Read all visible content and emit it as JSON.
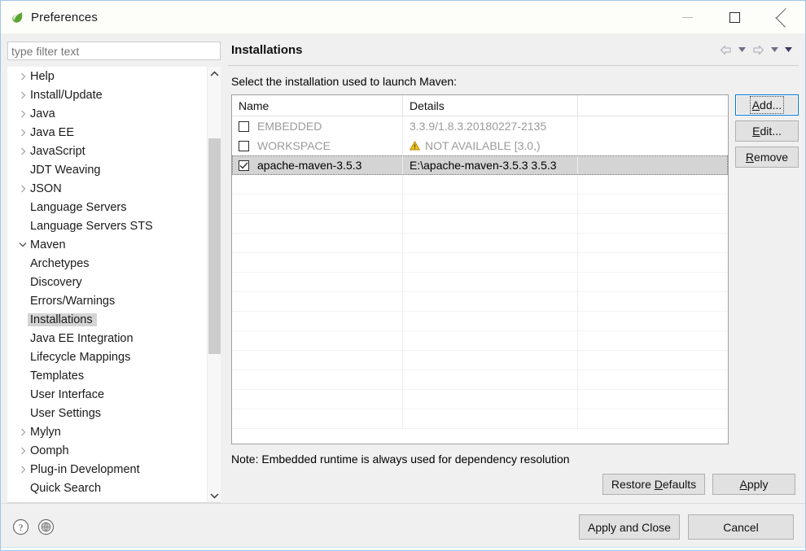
{
  "window": {
    "title": "Preferences",
    "logo_icon": "spring-leaf-icon",
    "controls": [
      {
        "name": "minimize-button",
        "icon": "minimize-icon"
      },
      {
        "name": "maximize-button",
        "icon": "maximize-icon"
      },
      {
        "name": "close-button",
        "icon": "close-icon"
      }
    ]
  },
  "filter": {
    "value": "",
    "placeholder": "type filter text"
  },
  "tree": {
    "items": [
      {
        "label": "Help",
        "depth": 1,
        "twisty": "collapsed",
        "selected": false
      },
      {
        "label": "Install/Update",
        "depth": 1,
        "twisty": "collapsed",
        "selected": false
      },
      {
        "label": "Java",
        "depth": 1,
        "twisty": "collapsed",
        "selected": false
      },
      {
        "label": "Java EE",
        "depth": 1,
        "twisty": "collapsed",
        "selected": false
      },
      {
        "label": "JavaScript",
        "depth": 1,
        "twisty": "collapsed",
        "selected": false
      },
      {
        "label": "JDT Weaving",
        "depth": 1,
        "twisty": "none",
        "selected": false
      },
      {
        "label": "JSON",
        "depth": 1,
        "twisty": "collapsed",
        "selected": false
      },
      {
        "label": "Language Servers",
        "depth": 1,
        "twisty": "none",
        "selected": false
      },
      {
        "label": "Language Servers STS",
        "depth": 1,
        "twisty": "none",
        "selected": false
      },
      {
        "label": "Maven",
        "depth": 1,
        "twisty": "expanded",
        "selected": false
      },
      {
        "label": "Archetypes",
        "depth": 2,
        "twisty": "none",
        "selected": false
      },
      {
        "label": "Discovery",
        "depth": 2,
        "twisty": "none",
        "selected": false
      },
      {
        "label": "Errors/Warnings",
        "depth": 2,
        "twisty": "none",
        "selected": false
      },
      {
        "label": "Installations",
        "depth": 2,
        "twisty": "none",
        "selected": true
      },
      {
        "label": "Java EE Integration",
        "depth": 2,
        "twisty": "none",
        "selected": false
      },
      {
        "label": "Lifecycle Mappings",
        "depth": 2,
        "twisty": "none",
        "selected": false
      },
      {
        "label": "Templates",
        "depth": 2,
        "twisty": "none",
        "selected": false
      },
      {
        "label": "User Interface",
        "depth": 2,
        "twisty": "none",
        "selected": false
      },
      {
        "label": "User Settings",
        "depth": 2,
        "twisty": "none",
        "selected": false
      },
      {
        "label": "Mylyn",
        "depth": 1,
        "twisty": "collapsed",
        "selected": false
      },
      {
        "label": "Oomph",
        "depth": 1,
        "twisty": "collapsed",
        "selected": false
      },
      {
        "label": "Plug-in Development",
        "depth": 1,
        "twisty": "collapsed",
        "selected": false
      },
      {
        "label": "Quick Search",
        "depth": 1,
        "twisty": "none",
        "selected": false
      }
    ],
    "scrollbar": {
      "up_icon": "chevron-up-icon",
      "down_icon": "chevron-down-icon"
    }
  },
  "page": {
    "title": "Installations",
    "nav": [
      {
        "name": "back-button",
        "icon": "arrow-left-icon",
        "enabled": false
      },
      {
        "name": "back-history-dropdown",
        "icon": "caret-down-icon",
        "enabled": false
      },
      {
        "name": "forward-button",
        "icon": "arrow-right-icon",
        "enabled": false
      },
      {
        "name": "forward-history-dropdown",
        "icon": "caret-down-icon",
        "enabled": false
      },
      {
        "name": "view-menu-dropdown",
        "icon": "caret-down-icon",
        "enabled": true
      }
    ],
    "description": "Select the installation used to launch Maven:",
    "note": "Note: Embedded runtime is always used for dependency resolution"
  },
  "table": {
    "columns": [
      "Name",
      "Details",
      ""
    ],
    "rows": [
      {
        "checked": false,
        "name": "EMBEDDED",
        "details": "3.3.9/1.8.3.20180227-2135",
        "dim": true,
        "warning": false,
        "selected": false
      },
      {
        "checked": false,
        "name": "WORKSPACE",
        "details": "NOT AVAILABLE [3.0,)",
        "dim": true,
        "warning": true,
        "selected": false
      },
      {
        "checked": true,
        "name": "apache-maven-3.5.3",
        "details": "E:\\apache-maven-3.5.3 3.5.3",
        "dim": false,
        "warning": false,
        "selected": true
      }
    ],
    "empty_row_count": 13
  },
  "side_buttons": [
    {
      "name": "add-button",
      "label": "Add...",
      "mnemonic": "A",
      "focused": true
    },
    {
      "name": "edit-button",
      "label": "Edit...",
      "mnemonic": "E",
      "focused": false
    },
    {
      "name": "remove-button",
      "label": "Remove",
      "mnemonic": "R",
      "focused": false
    }
  ],
  "page_buttons": [
    {
      "name": "restore-defaults-button",
      "label": "Restore Defaults",
      "mnemonic": "D"
    },
    {
      "name": "apply-button",
      "label": "Apply",
      "mnemonic": "A"
    }
  ],
  "footer": {
    "icons": [
      {
        "name": "help-icon",
        "glyph": "?"
      },
      {
        "name": "globe-icon",
        "glyph": "globe"
      }
    ],
    "buttons": [
      {
        "name": "apply-and-close-button",
        "label": "Apply and Close"
      },
      {
        "name": "cancel-button",
        "label": "Cancel"
      }
    ]
  },
  "colors": {
    "accent": "#0078d7",
    "selection": "#d4d4d4",
    "warning": "#e8b020",
    "logo_green": "#5aa32f",
    "dim_text": "#9b9b9b"
  }
}
